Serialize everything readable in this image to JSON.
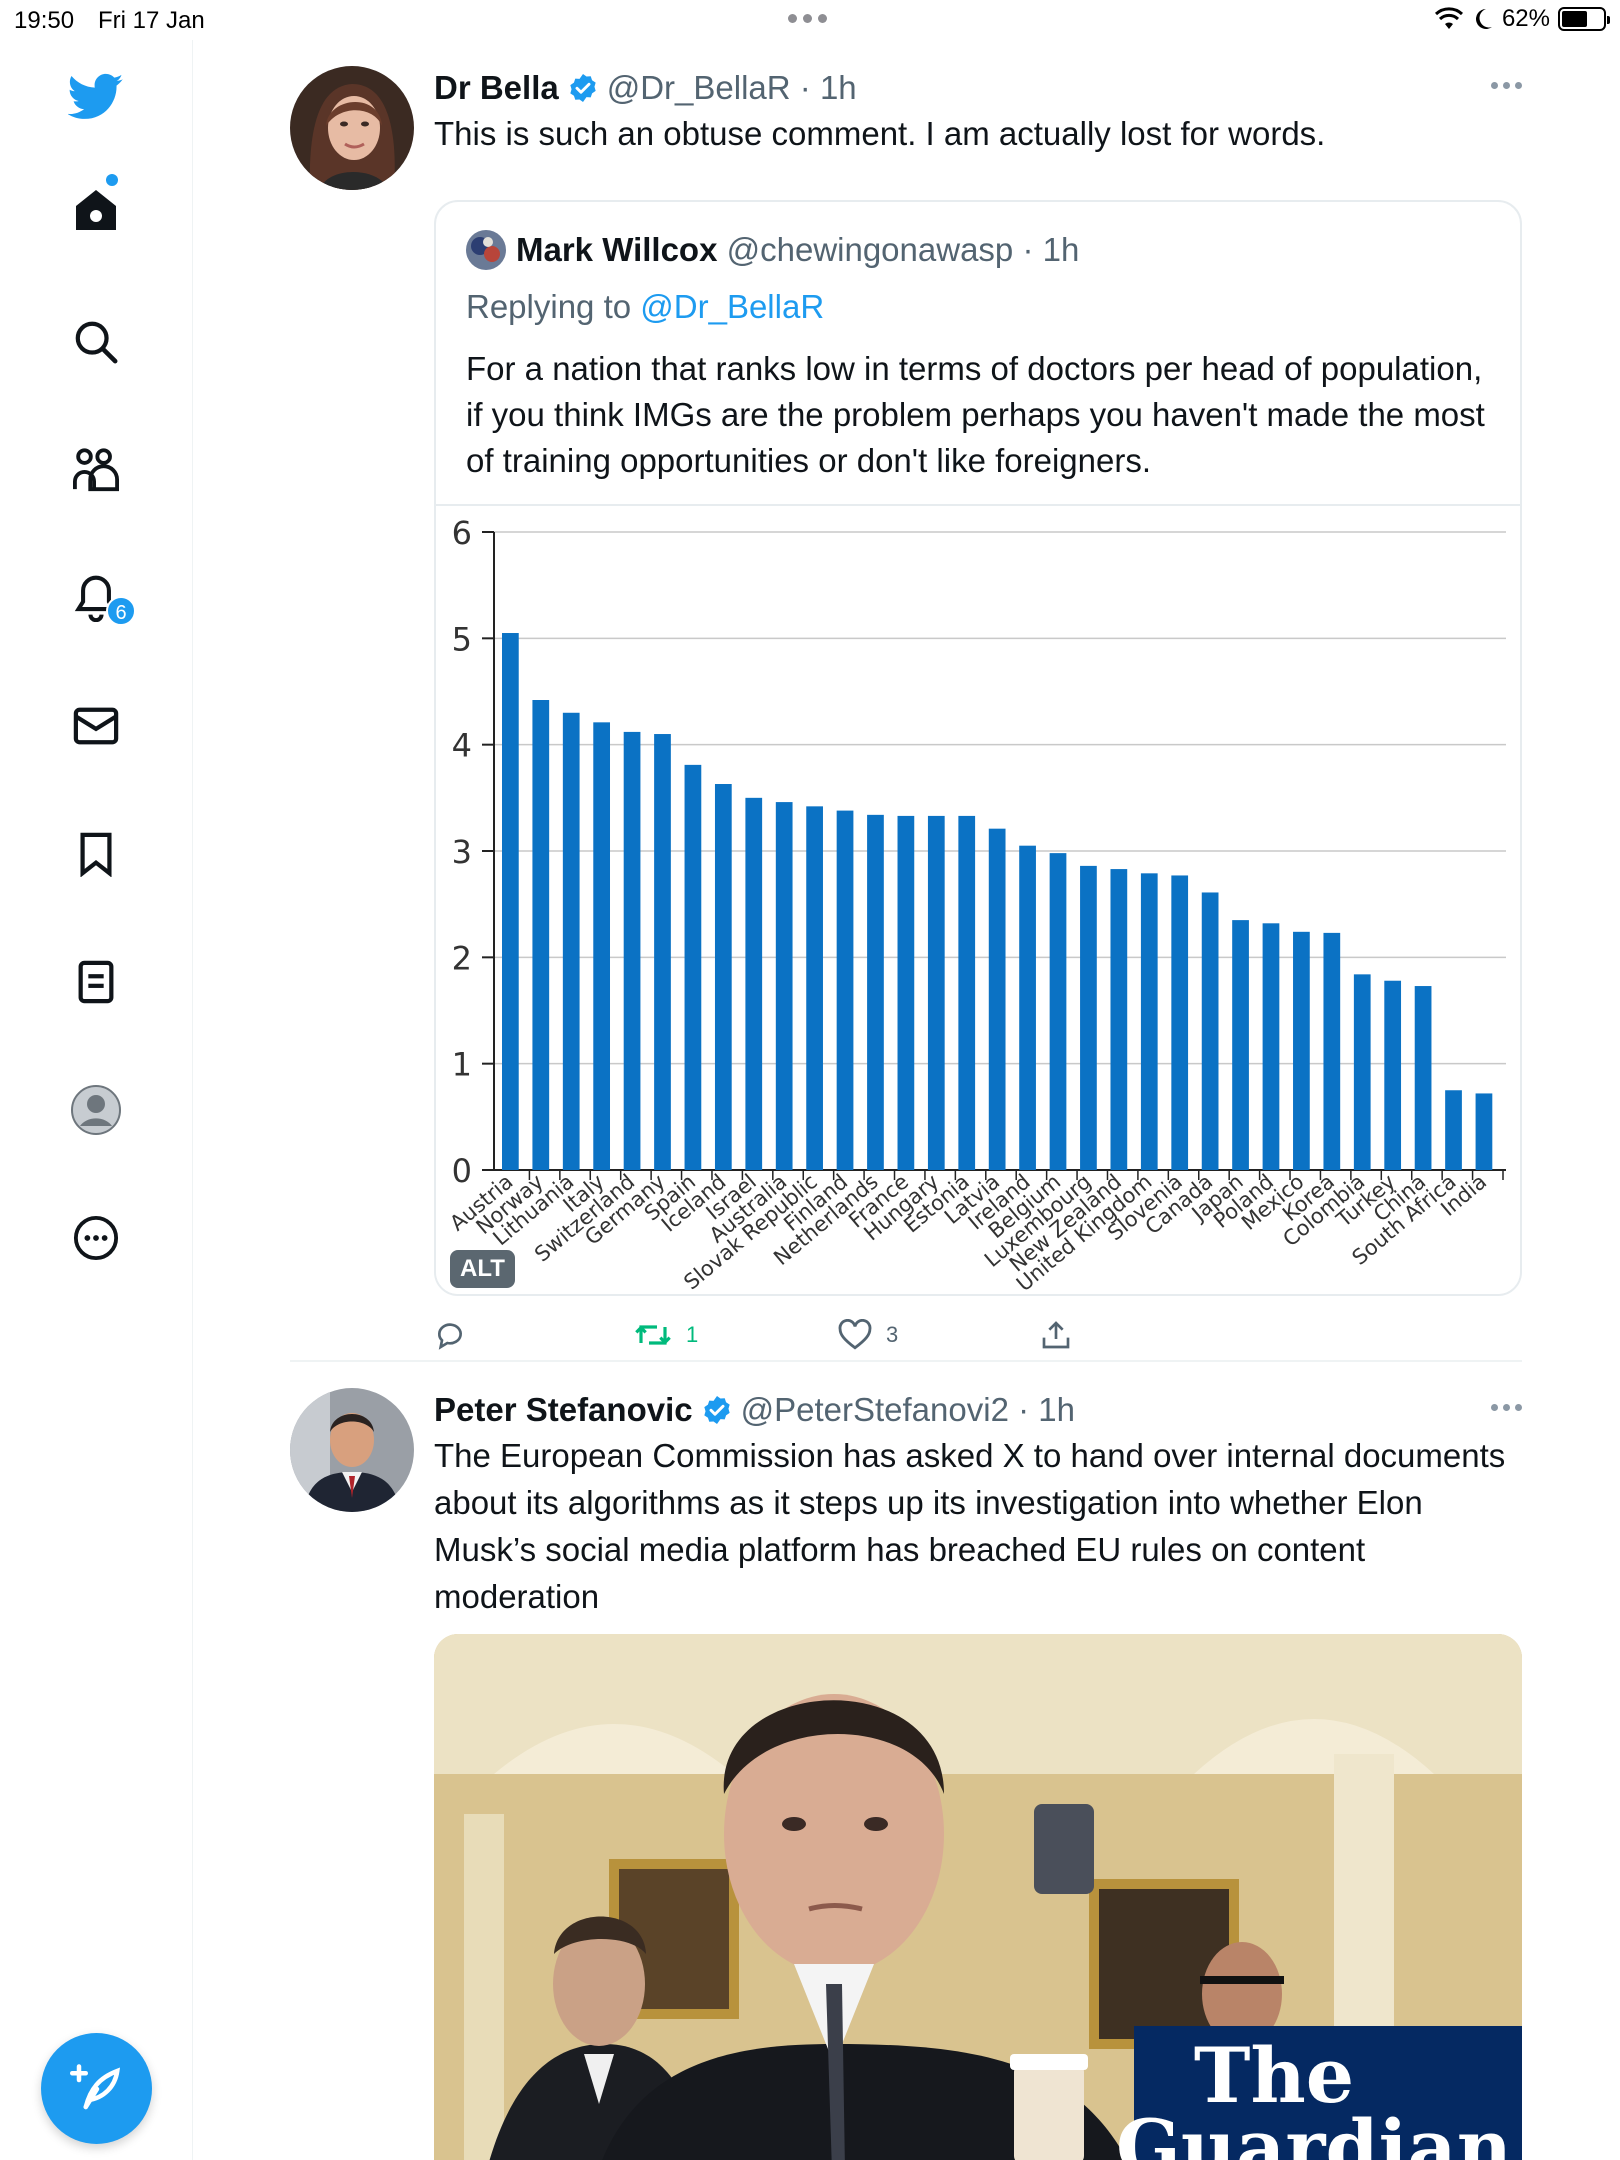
{
  "status_bar": {
    "time": "19:50",
    "date": "Fri 17 Jan",
    "battery": "62%",
    "battery_level": 0.62
  },
  "sidebar": {
    "items": [
      {
        "icon": "twitter-bird-icon"
      },
      {
        "icon": "home-icon"
      },
      {
        "icon": "search-icon"
      },
      {
        "icon": "communities-icon"
      },
      {
        "icon": "notifications-icon",
        "badge": "6"
      },
      {
        "icon": "messages-icon"
      },
      {
        "icon": "bookmarks-icon"
      },
      {
        "icon": "lists-icon"
      },
      {
        "icon": "profile-icon"
      },
      {
        "icon": "more-icon"
      }
    ],
    "compose_icon": "compose-tweet-icon"
  },
  "tweet1": {
    "name": "Dr Bella",
    "handle": "@Dr_BellaR",
    "time": "1h",
    "text": "This is such an obtuse comment. I am actually lost for words.",
    "quote": {
      "name": "Mark Willcox",
      "handle": "@chewingonawasp",
      "time": "1h",
      "replying_prefix": "Replying to ",
      "replying_to": "@Dr_BellaR",
      "text": "For a nation that ranks low in terms of doctors per head of population, if you think IMGs are the problem perhaps you haven't made the most of training opportunities or don't like foreigners.",
      "alt_label": "ALT"
    },
    "replies": "",
    "retweets": "1",
    "likes": "3"
  },
  "tweet2": {
    "name": "Peter Stefanovic",
    "handle": "@PeterStefanovi2",
    "time": "1h",
    "text": "The European Commission has asked X to hand over internal documents about its algorithms as it steps up its investigation into whether Elon Musk’s social media platform has breached EU rules on content moderation",
    "media_brand_line1": "The",
    "media_brand_line2": "Guardian"
  },
  "colors": {
    "accent": "#1d9bf0",
    "bar": "#0b72c4",
    "retweet": "#00ba7c",
    "guardian": "#052962"
  },
  "chart_data": {
    "type": "bar",
    "categories": [
      "Austria",
      "Norway",
      "Lithuania",
      "Italy",
      "Switzerland",
      "Germany",
      "Spain",
      "Iceland",
      "Israel",
      "Australia",
      "Slovak Republic",
      "Finland",
      "Netherlands",
      "France",
      "Hungary",
      "Estonia",
      "Latvia",
      "Ireland",
      "Belgium",
      "Luxembourg",
      "New Zealand",
      "United Kingdom",
      "Slovenia",
      "Canada",
      "Japan",
      "Poland",
      "Mexico",
      "Korea",
      "Colombia",
      "Turkey",
      "China",
      "South Africa",
      "India"
    ],
    "values": [
      5.05,
      4.42,
      4.3,
      4.21,
      4.12,
      4.1,
      3.81,
      3.63,
      3.5,
      3.46,
      3.42,
      3.38,
      3.34,
      3.33,
      3.33,
      3.33,
      3.21,
      3.05,
      2.98,
      2.86,
      2.83,
      2.79,
      2.77,
      2.61,
      2.35,
      2.32,
      2.24,
      2.23,
      1.84,
      1.78,
      1.73,
      0.75,
      0.72
    ],
    "ylim": [
      0,
      6
    ],
    "yticks": [
      "0",
      "1",
      "2",
      "3",
      "4",
      "5",
      "6"
    ],
    "grid": true
  }
}
